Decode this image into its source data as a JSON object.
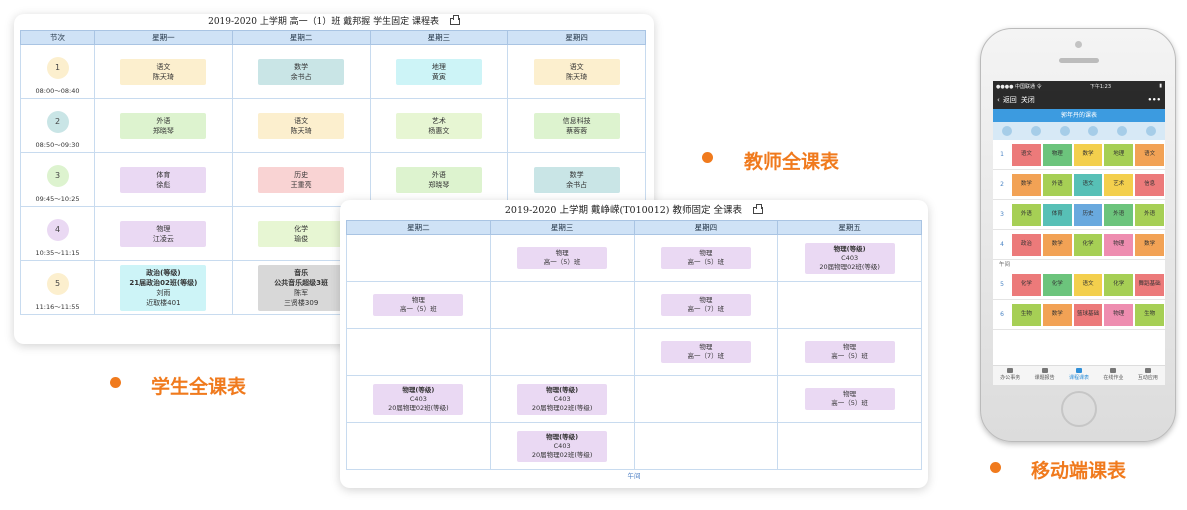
{
  "student": {
    "title": "2019-2020 上学期 高一（1）班 戴邦握 学生固定 课程表",
    "headers": [
      "节次",
      "星期一",
      "星期二",
      "星期三",
      "星期四"
    ],
    "periods": [
      {
        "num": "1",
        "time": "08:00～08:40"
      },
      {
        "num": "2",
        "time": "08:50～09:30"
      },
      {
        "num": "3",
        "time": "09:45～10:25"
      },
      {
        "num": "4",
        "time": "10:35～11:15"
      },
      {
        "num": "5",
        "time": "11:16～11:55"
      }
    ],
    "rows": [
      [
        {
          "lines": [
            "语文",
            "陈天琦"
          ]
        },
        {
          "lines": [
            "数学",
            "余书占"
          ]
        },
        {
          "lines": [
            "地理",
            "黄寅"
          ]
        },
        {
          "lines": [
            "语文",
            "陈天琦"
          ]
        }
      ],
      [
        {
          "lines": [
            "外语",
            "郑晓琴"
          ]
        },
        {
          "lines": [
            "语文",
            "陈天琦"
          ]
        },
        {
          "lines": [
            "艺术",
            "杨惠文"
          ]
        },
        {
          "lines": [
            "信息科技",
            "蔡蓉蓉"
          ]
        }
      ],
      [
        {
          "lines": [
            "体育",
            "徐彪"
          ]
        },
        {
          "lines": [
            "历史",
            "王重亮"
          ]
        },
        {
          "lines": [
            "外语",
            "郑晓琴"
          ]
        },
        {
          "lines": [
            "数学",
            "余书占"
          ]
        }
      ],
      [
        {
          "lines": [
            "物理",
            "江凌云"
          ]
        },
        {
          "lines": [
            "化学",
            "瑜俊"
          ]
        },
        {
          "lines": []
        },
        {
          "lines": []
        }
      ],
      [
        {
          "lines": [
            "政治(等级)",
            "21届政治02班(等级)",
            "刘雨",
            "近取楼401"
          ]
        },
        {
          "lines": [
            "音乐",
            "公共音乐超级3班",
            "陈军",
            "三贤楼309"
          ]
        },
        {
          "lines": []
        },
        {
          "lines": []
        }
      ]
    ]
  },
  "teacher": {
    "title": "2019-2020 上学期 戴峥嵘(T010012) 教师固定 全课表",
    "headers": [
      "星期二",
      "星期三",
      "星期四",
      "星期五"
    ],
    "rows": [
      [
        [],
        [
          "物理",
          "高一（5）班"
        ],
        [
          "物理",
          "高一（5）班"
        ],
        [
          "物理(等级)",
          "C403",
          "20届物理02班(等级)"
        ]
      ],
      [
        [
          "物理",
          "高一（5）班"
        ],
        [],
        [
          "物理",
          "高一（7）班"
        ],
        []
      ],
      [
        [],
        [],
        [
          "物理",
          "高一（7）班"
        ],
        [
          "物理",
          "高一（5）班"
        ]
      ],
      [
        [
          "物理(等级)",
          "C403",
          "20届物理02班(等级)"
        ],
        [
          "物理(等级)",
          "C403",
          "20届物理02班(等级)"
        ],
        [],
        [
          "物理",
          "高一（5）班"
        ]
      ],
      [
        [],
        [
          "物理(等级)",
          "C403",
          "20届物理02班(等级)"
        ],
        [],
        []
      ]
    ],
    "noon_label": "午间"
  },
  "features": {
    "teacher": "教师全课表",
    "student": "学生全课表",
    "mobile": "移动端课表"
  },
  "phone": {
    "status_left": "●●●● 中国联通 令",
    "status_time": "下午1:23",
    "status_right": "▮",
    "back_label": "返回",
    "close_label": "关闭",
    "more_label": "•••",
    "title": "郭年丹的课表",
    "noon_label": "午间",
    "rows": [
      {
        "num": "1",
        "cells": [
          "语文",
          "物理",
          "数学",
          "地理",
          "语文"
        ]
      },
      {
        "num": "2",
        "cells": [
          "数学",
          "外语",
          "语文",
          "艺术",
          "信息"
        ]
      },
      {
        "num": "3",
        "cells": [
          "外语",
          "体育",
          "历史",
          "外语",
          "外语"
        ]
      },
      {
        "num": "4",
        "cells": [
          "政治",
          "数学",
          "化学",
          "物理",
          "数学"
        ]
      },
      {
        "num": "5",
        "cells": [
          "化学",
          "化学",
          "语文",
          "化学",
          "舞蹈基础"
        ]
      },
      {
        "num": "6",
        "cells": [
          "生物",
          "数学",
          "篮球基础",
          "物理",
          "生物"
        ]
      }
    ],
    "tabs": [
      "办公事务",
      "课题报告",
      "课程课表",
      "在线作业",
      "互动应用"
    ],
    "active_tab": 2
  },
  "colors": {
    "accent": "#f07a1d",
    "header_blue": "#cfe2f6",
    "phone_blue": "#3c9be0"
  }
}
